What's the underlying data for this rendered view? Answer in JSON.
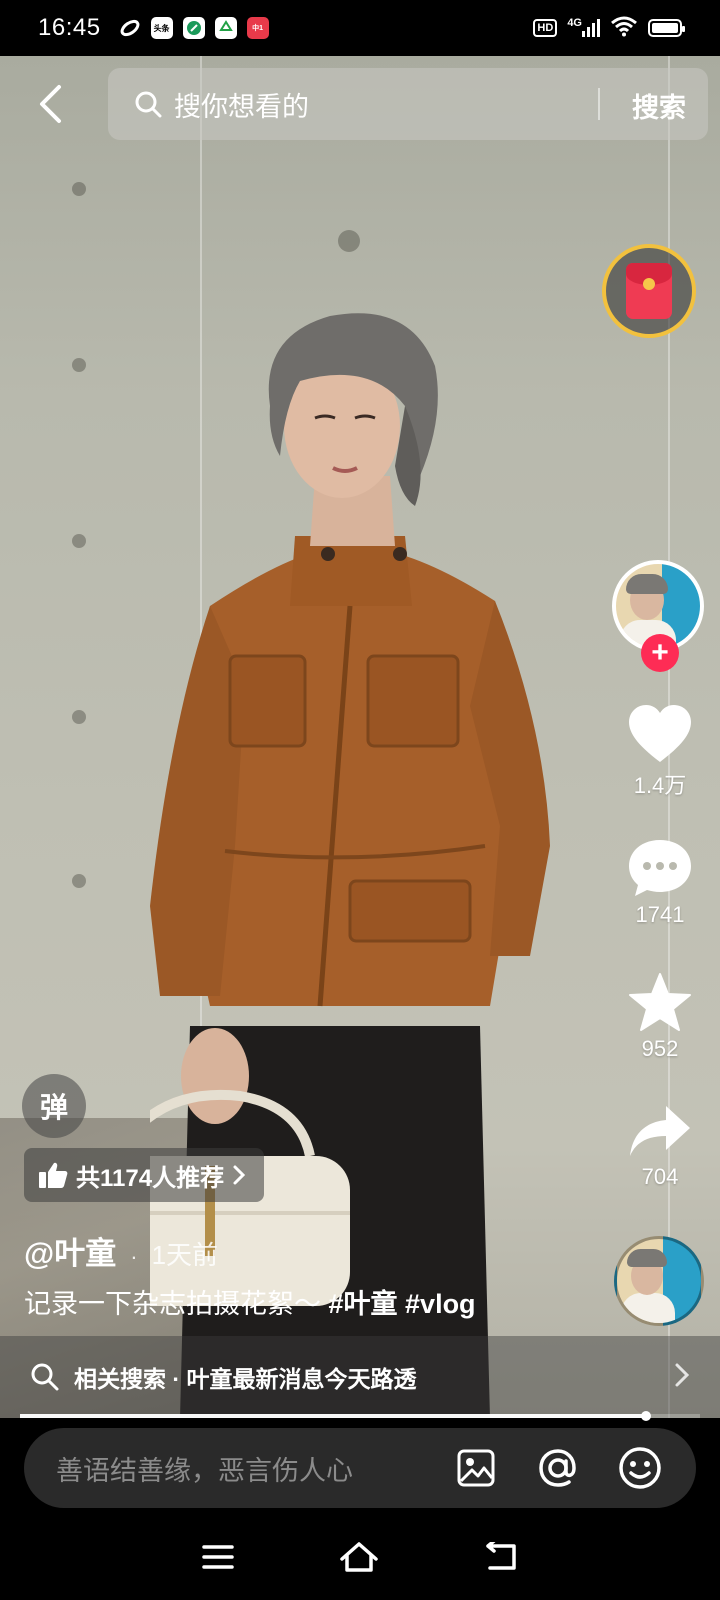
{
  "status_bar": {
    "time": "16:45",
    "signal_label": "4G",
    "hd_label": "HD"
  },
  "search": {
    "placeholder": "搜你想看的",
    "button_label": "搜索"
  },
  "rail": {
    "likes": "1.4万",
    "comments": "1741",
    "favorites": "952",
    "shares": "704"
  },
  "overlay": {
    "danmaku_label": "弹",
    "recommend_text": "共1174人推荐",
    "author": "@叶童",
    "separator": "·",
    "time_ago": "1天前",
    "description": "记录一下杂志拍摄花絮～ ",
    "hashtags": "#叶童 #vlog"
  },
  "related": {
    "text": "相关搜索 · 叶童最新消息今天路透"
  },
  "progress": {
    "fraction": 0.92
  },
  "comment": {
    "placeholder": "善语结善缘，恶言伤人心"
  },
  "colors": {
    "accent_red": "#fe2c55",
    "gold_ring": "#f2c13e"
  }
}
